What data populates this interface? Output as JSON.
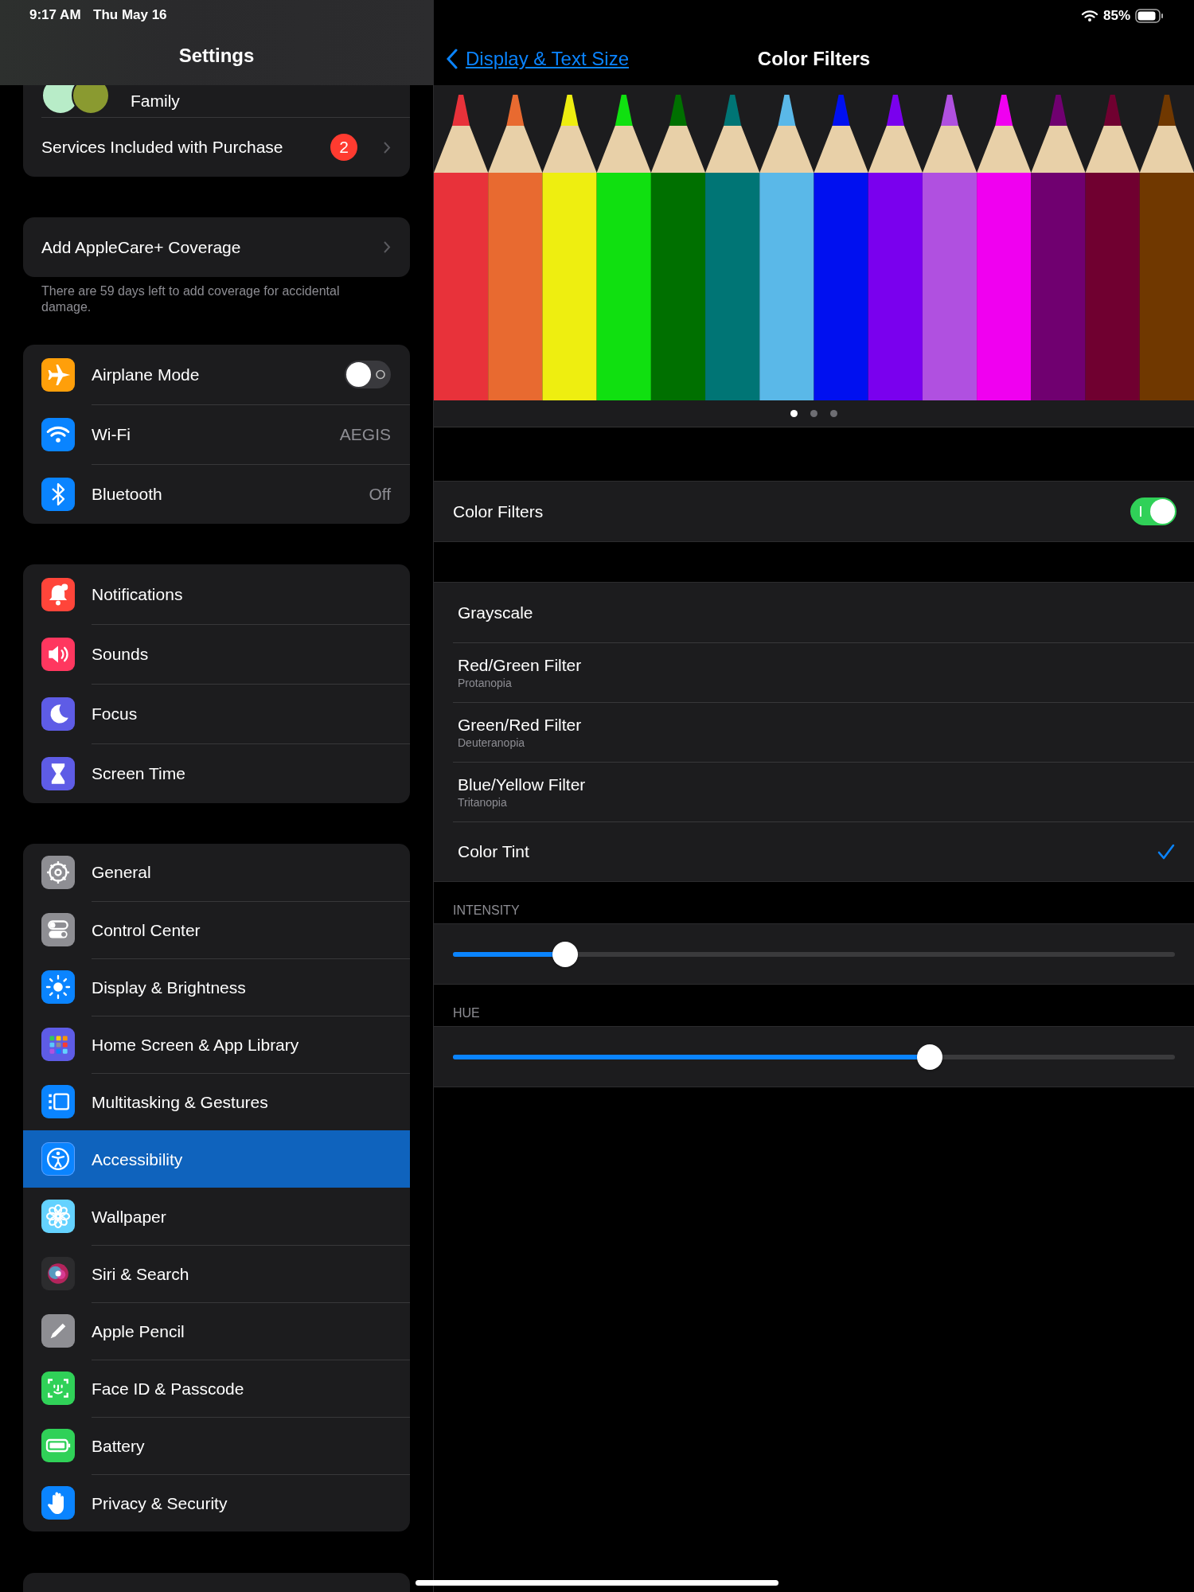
{
  "status_bar": {
    "time": "9:17 AM",
    "date": "Thu May 16",
    "battery": "85%"
  },
  "sidebar": {
    "title": "Settings",
    "groups": [
      {
        "items": [
          {
            "kind": "family",
            "label": "Family",
            "selected": false
          },
          {
            "kind": "link",
            "label": "Services Included with Purchase",
            "badge": "2",
            "selected": false
          }
        ]
      },
      {
        "items": [
          {
            "kind": "link",
            "label": "Add AppleCare+ Coverage",
            "selected": false
          }
        ],
        "footer": "There are 59 days left to add coverage for accidental damage."
      },
      {
        "items": [
          {
            "kind": "toggle",
            "label": "Airplane Mode",
            "on": false,
            "color": "#ff9f0a",
            "selected": false
          },
          {
            "kind": "value",
            "label": "Wi-Fi",
            "value": "AEGIS",
            "color": "#0a84ff",
            "selected": false
          },
          {
            "kind": "value",
            "label": "Bluetooth",
            "value": "Off",
            "color": "#0a84ff",
            "selected": false
          }
        ]
      },
      {
        "items": [
          {
            "kind": "plain",
            "label": "Notifications",
            "color": "#ff453a",
            "selected": false
          },
          {
            "kind": "plain",
            "label": "Sounds",
            "color": "#ff375f",
            "selected": false
          },
          {
            "kind": "plain",
            "label": "Focus",
            "color": "#5e5ce6",
            "selected": false
          },
          {
            "kind": "plain",
            "label": "Screen Time",
            "color": "#5e5ce6",
            "selected": false
          }
        ]
      },
      {
        "items": [
          {
            "kind": "plain",
            "label": "General",
            "color": "#8e8e93",
            "selected": false
          },
          {
            "kind": "plain",
            "label": "Control Center",
            "color": "#8e8e93",
            "selected": false
          },
          {
            "kind": "plain",
            "label": "Display & Brightness",
            "color": "#0a84ff",
            "selected": false
          },
          {
            "kind": "plain",
            "label": "Home Screen & App Library",
            "color": "#5e5ce6",
            "selected": false
          },
          {
            "kind": "plain",
            "label": "Multitasking & Gestures",
            "color": "#0a84ff",
            "selected": false
          },
          {
            "kind": "plain",
            "label": "Accessibility",
            "color": "#0a84ff",
            "selected": true
          },
          {
            "kind": "plain",
            "label": "Wallpaper",
            "color": "#64d2ff",
            "selected": false
          },
          {
            "kind": "plain",
            "label": "Siri & Search",
            "color": "#2c2c2e",
            "selected": false
          },
          {
            "kind": "plain",
            "label": "Apple Pencil",
            "color": "#8e8e93",
            "selected": false
          },
          {
            "kind": "plain",
            "label": "Face ID & Passcode",
            "color": "#30d158",
            "selected": false
          },
          {
            "kind": "plain",
            "label": "Battery",
            "color": "#30d158",
            "selected": false
          },
          {
            "kind": "plain",
            "label": "Privacy & Security",
            "color": "#0a84ff",
            "selected": false
          }
        ]
      }
    ]
  },
  "detail": {
    "back": "Display & Text Size",
    "title": "Color Filters",
    "carousel": {
      "kind": "picture",
      "pages": [
        {
          "selected": true
        },
        {
          "selected": false
        },
        {
          "selected": false
        }
      ]
    },
    "switch": {
      "label": "Color Filters",
      "on": true
    },
    "filters": [
      {
        "label": "Grayscale",
        "selected": false
      },
      {
        "label": "Red/Green Filter",
        "subtitle": "Protanopia",
        "selected": false
      },
      {
        "label": "Green/Red Filter",
        "subtitle": "Deuteranopia",
        "selected": false
      },
      {
        "label": "Blue/Yellow Filter",
        "subtitle": "Tritanopia",
        "selected": false
      },
      {
        "label": "Color Tint",
        "selected": true
      }
    ],
    "sliders": [
      {
        "header": "INTENSITY",
        "level": 0.155
      },
      {
        "header": "HUE",
        "level": 0.66
      }
    ]
  }
}
